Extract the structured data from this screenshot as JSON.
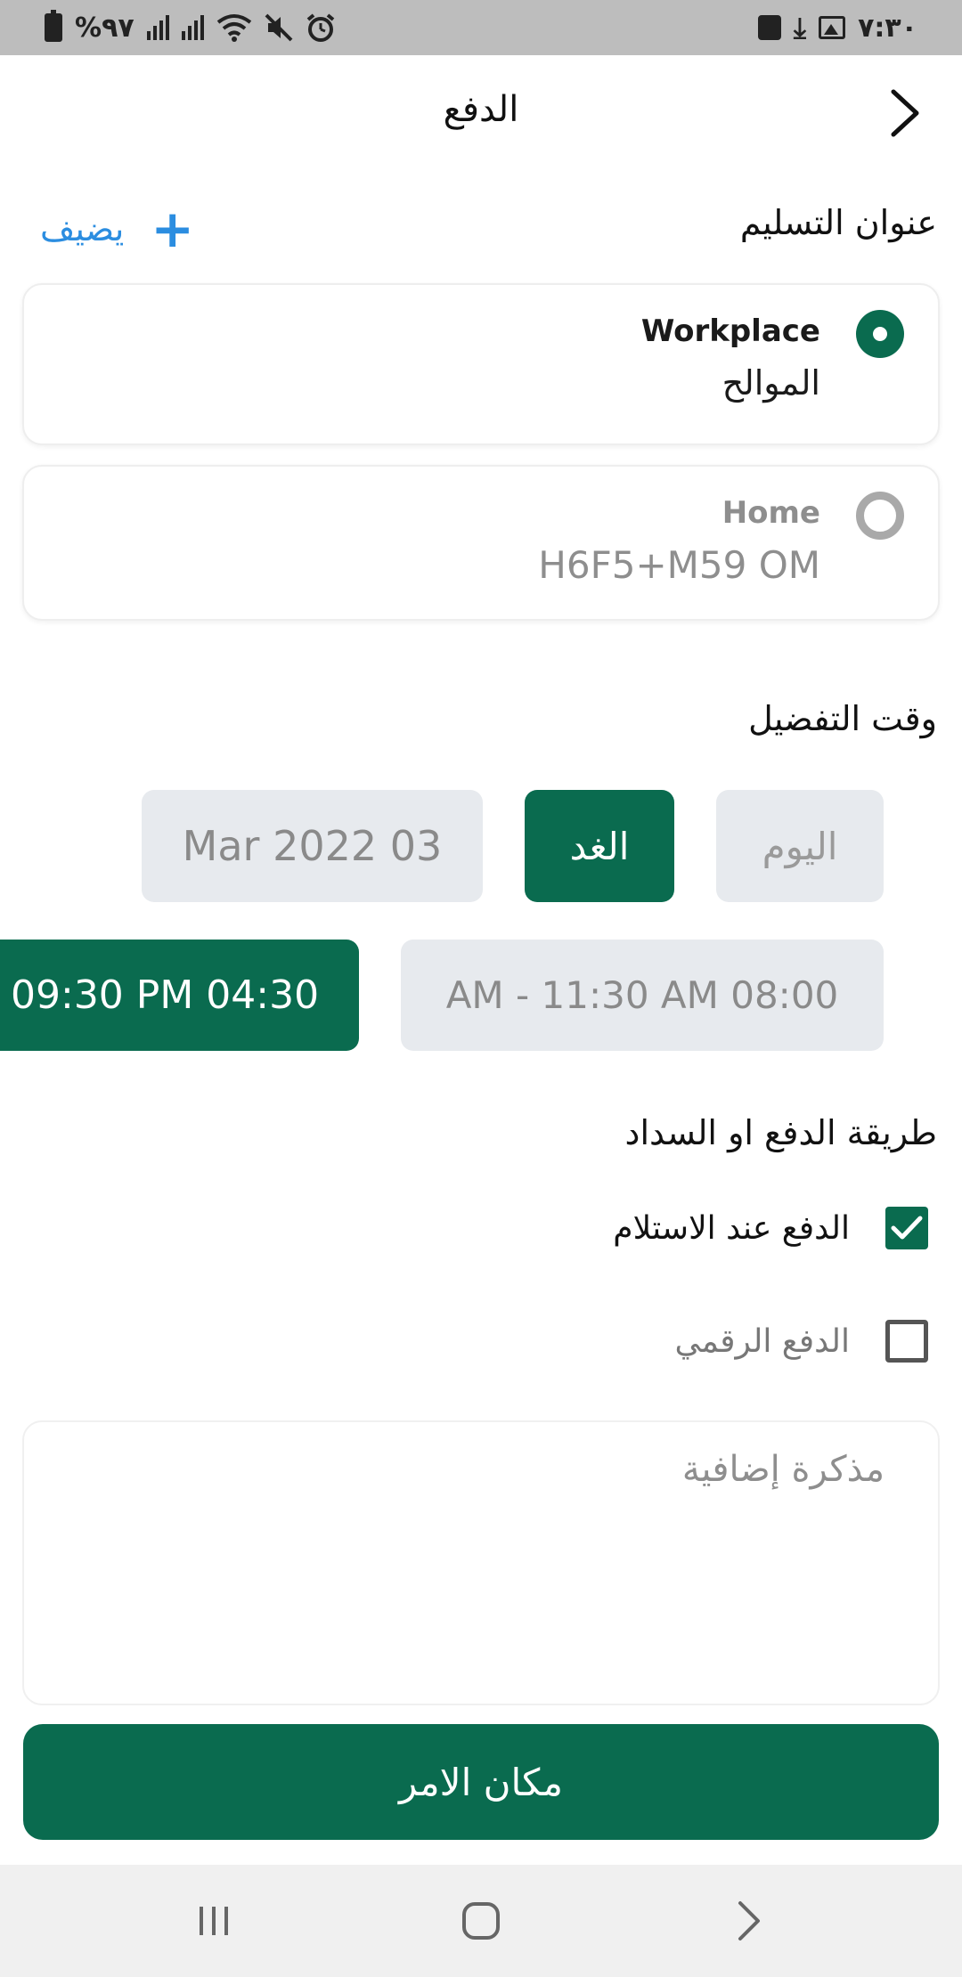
{
  "status_bar": {
    "battery": "%٩٧",
    "time": "٧:٣٠"
  },
  "header": {
    "title": "الدفع"
  },
  "delivery": {
    "section_title": "عنوان التسليم",
    "add_label": "يضيف",
    "addresses": [
      {
        "name": "Workplace",
        "line": "الموالح",
        "selected": true
      },
      {
        "name": "Home",
        "line": "H6F5+M59  OM",
        "selected": false
      }
    ]
  },
  "preferred_time": {
    "section_title": "وقت التفضيل",
    "days": [
      {
        "label": "اليوم",
        "active": false
      },
      {
        "label": "الغد",
        "active": true
      },
      {
        "label": "Mar 2022 03",
        "active": false
      }
    ],
    "slots": [
      {
        "label": "AM - 11:30 AM 08:00",
        "active": false
      },
      {
        "label": "09:30 PM 04:30",
        "active": true
      }
    ]
  },
  "payment": {
    "section_title": "طريقة الدفع او السداد",
    "options": [
      {
        "label": "الدفع عند الاستلام",
        "checked": true
      },
      {
        "label": "الدفع الرقمي",
        "checked": false
      }
    ]
  },
  "notes": {
    "placeholder": "مذكرة إضافية"
  },
  "submit": {
    "label": "مكان الامر"
  },
  "colors": {
    "primary": "#0a6b4f",
    "accent_link": "#2b8de0",
    "chip_inactive": "#e7eaee"
  }
}
